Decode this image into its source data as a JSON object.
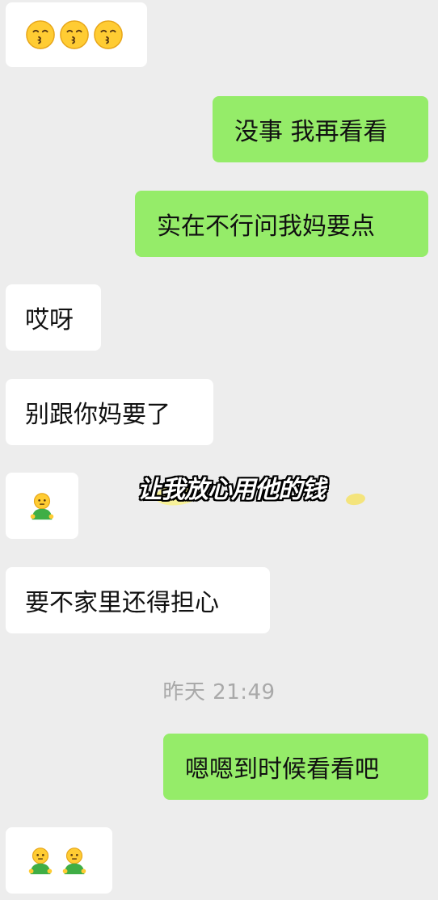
{
  "messages": [
    {
      "side": "left",
      "type": "emoji",
      "emojis": [
        "kissing-face-icon",
        "kissing-face-icon",
        "kissing-face-icon"
      ]
    },
    {
      "side": "right",
      "type": "text",
      "text": "没事 我再看看"
    },
    {
      "side": "right",
      "type": "text",
      "text": "实在不行问我妈要点"
    },
    {
      "side": "left",
      "type": "text",
      "text": "哎呀"
    },
    {
      "side": "left",
      "type": "text",
      "text": "别跟你妈要了"
    },
    {
      "side": "left",
      "type": "emoji",
      "emojis": [
        "green-person-emoji-icon"
      ]
    },
    {
      "side": "left",
      "type": "text",
      "text": "要不家里还得担心"
    },
    {
      "side": "right",
      "type": "text",
      "text": "嗯嗯到时候看看吧"
    },
    {
      "side": "left",
      "type": "emoji",
      "emojis": [
        "green-person-emoji-icon",
        "green-person-emoji-icon"
      ]
    }
  ],
  "timestamp": "昨天 21:49",
  "overlay_caption": "让我放心用他的钱",
  "colors": {
    "background": "#ededed",
    "incoming_bubble": "#ffffff",
    "outgoing_bubble": "#95ec69",
    "timestamp_text": "#a9a9a9"
  }
}
